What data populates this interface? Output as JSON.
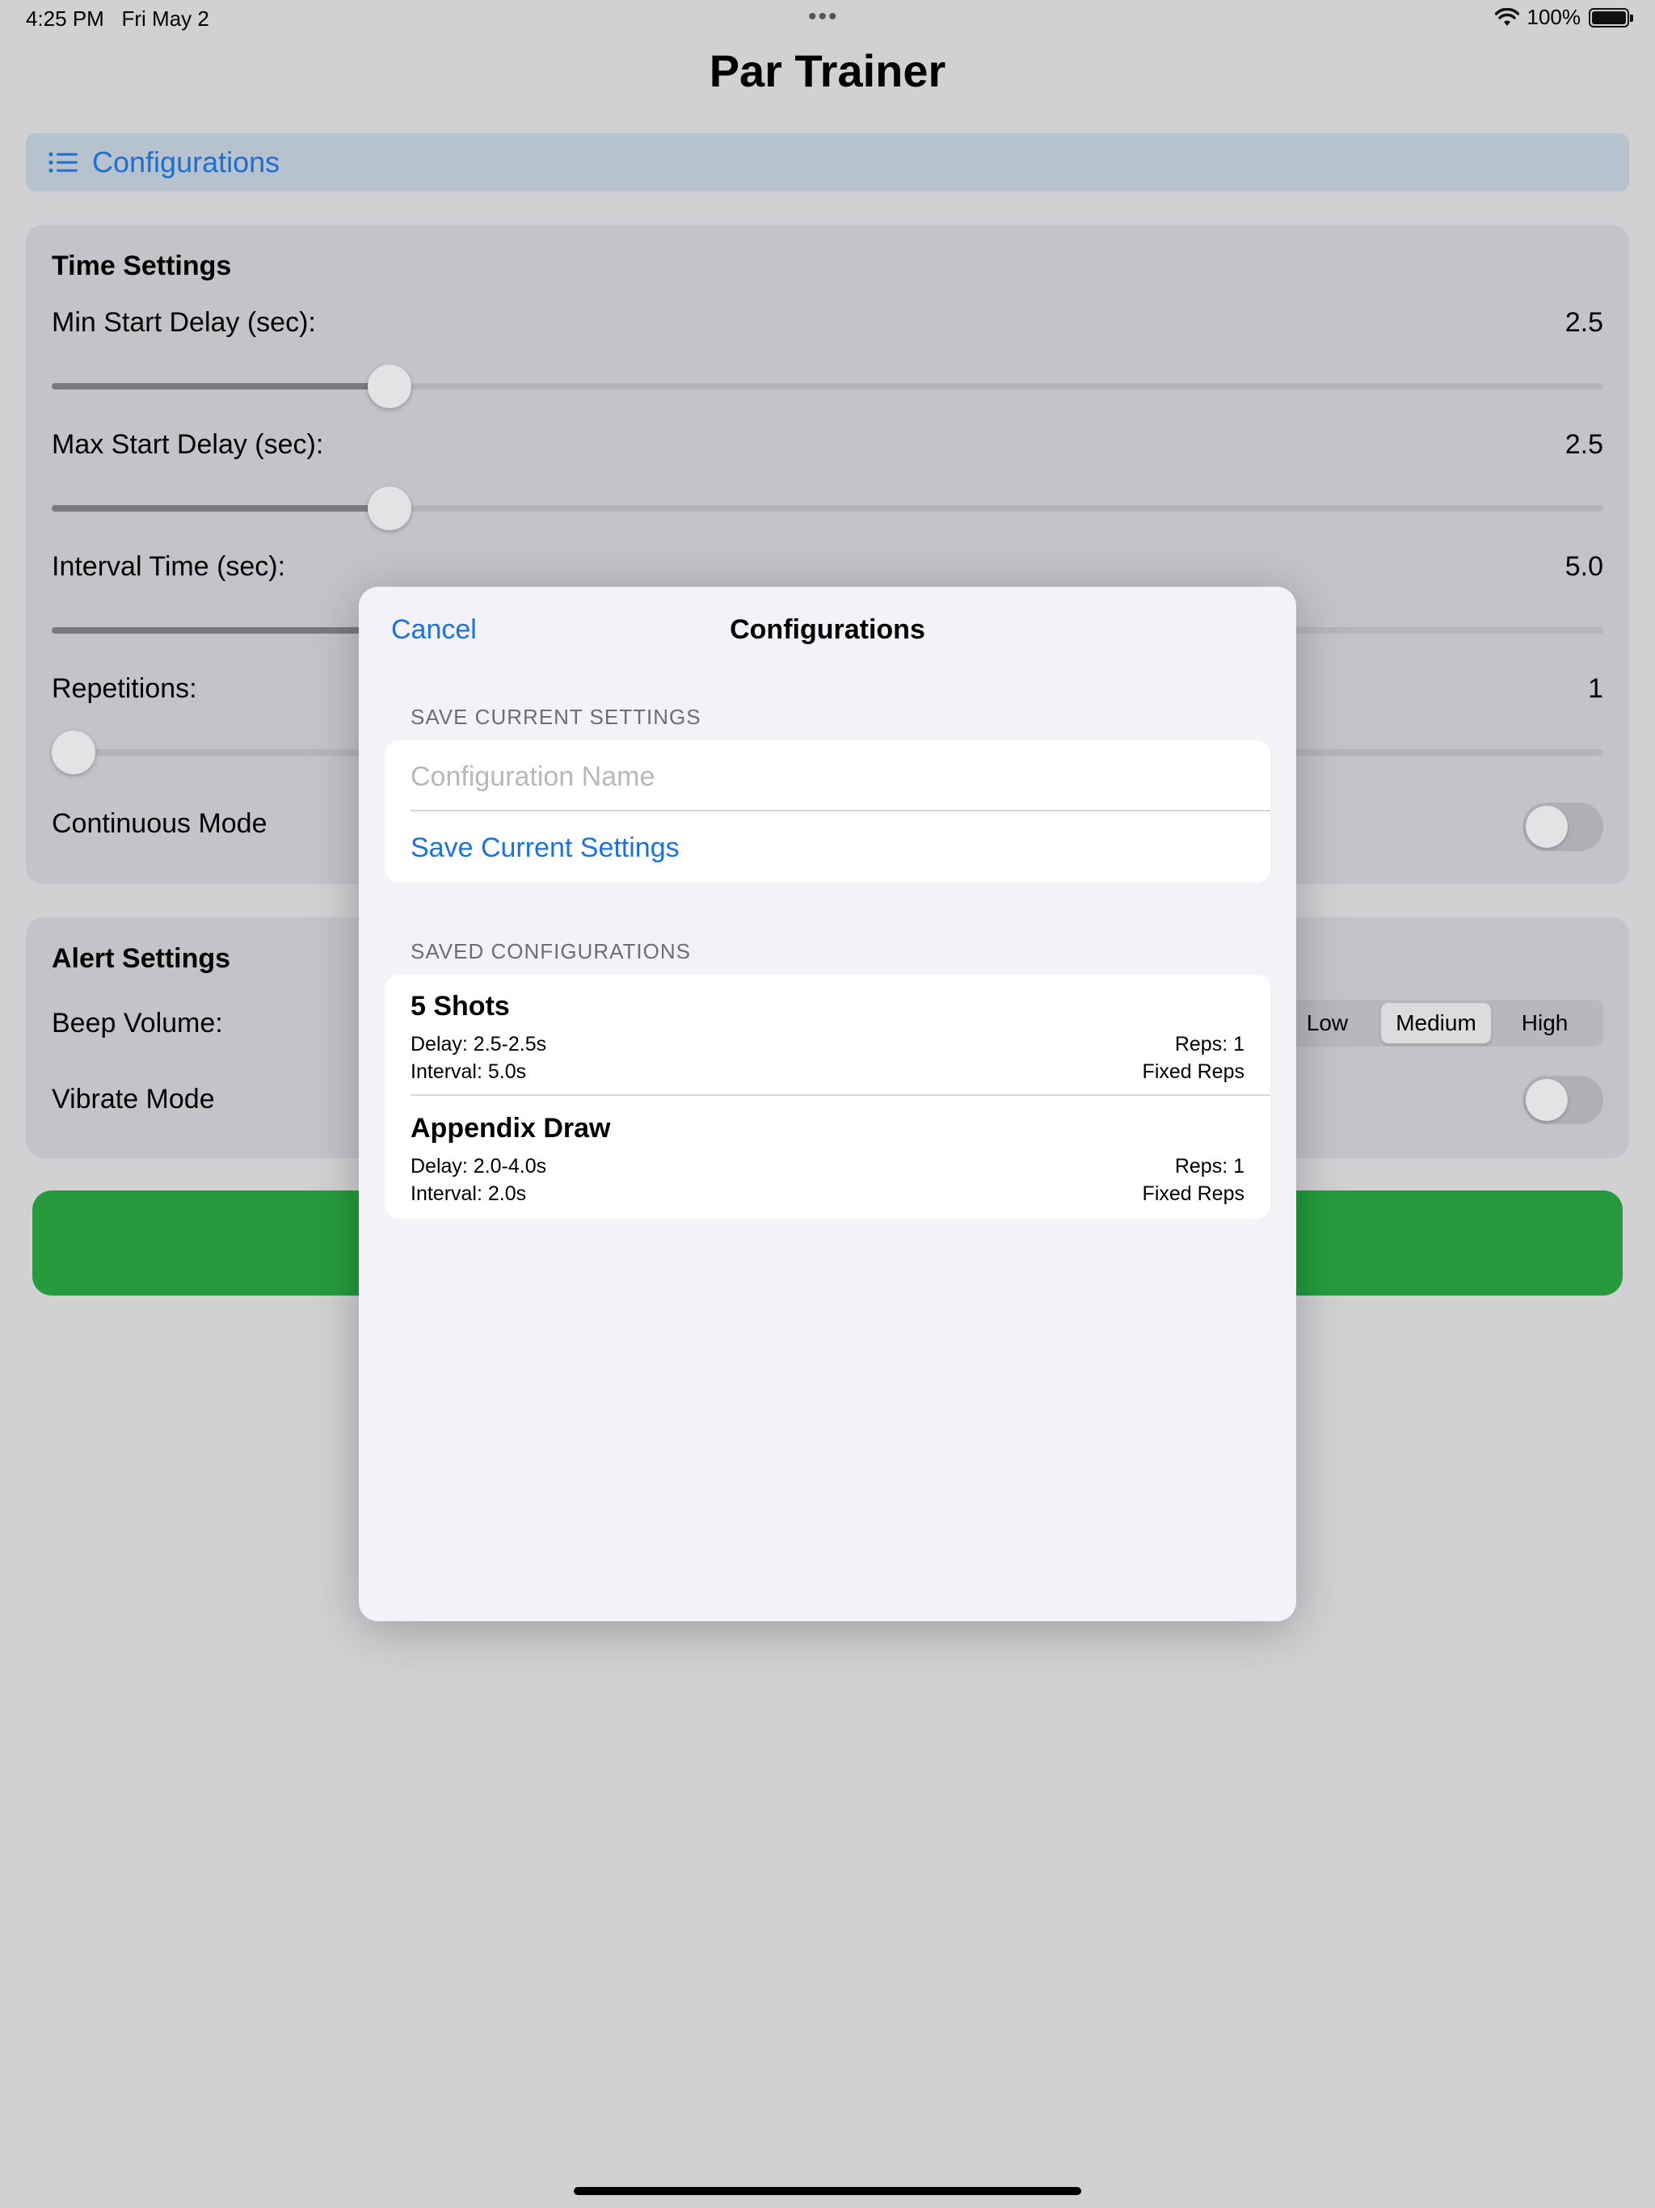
{
  "status": {
    "time": "4:25 PM",
    "date": "Fri May 2",
    "battery": "100%"
  },
  "app": {
    "title": "Par Trainer"
  },
  "config_bar": {
    "label": "Configurations"
  },
  "time_settings": {
    "title": "Time Settings",
    "min_start_delay": {
      "label": "Min Start Delay (sec):",
      "value": "2.5",
      "fraction": 0.22
    },
    "max_start_delay": {
      "label": "Max Start Delay (sec):",
      "value": "2.5",
      "fraction": 0.22
    },
    "interval_time": {
      "label": "Interval Time (sec):",
      "value": "5.0"
    },
    "repetitions": {
      "label": "Repetitions:",
      "value": "1",
      "fraction": 0
    },
    "continuous_mode": {
      "label": "Continuous Mode",
      "on": false
    }
  },
  "alert_settings": {
    "title": "Alert Settings",
    "beep_volume": {
      "label": "Beep Volume:",
      "options": [
        "Low",
        "Medium",
        "High"
      ],
      "selected": "Medium"
    },
    "vibrate_mode": {
      "label": "Vibrate Mode",
      "on": false
    }
  },
  "start_button": {
    "color": "#269a3d"
  },
  "modal": {
    "cancel": "Cancel",
    "title": "Configurations",
    "save_section_header": "SAVE CURRENT SETTINGS",
    "name_placeholder": "Configuration Name",
    "save_button": "Save Current Settings",
    "saved_section_header": "SAVED CONFIGURATIONS",
    "configs": [
      {
        "name": "5 Shots",
        "delay": "Delay: 2.5-2.5s",
        "interval": "Interval: 5.0s",
        "reps": "Reps: 1",
        "mode": "Fixed Reps"
      },
      {
        "name": "Appendix Draw",
        "delay": "Delay: 2.0-4.0s",
        "interval": "Interval: 2.0s",
        "reps": "Reps: 1",
        "mode": "Fixed Reps"
      }
    ]
  },
  "colors": {
    "accent": "#1a73e0",
    "start_green": "#269a3d"
  }
}
